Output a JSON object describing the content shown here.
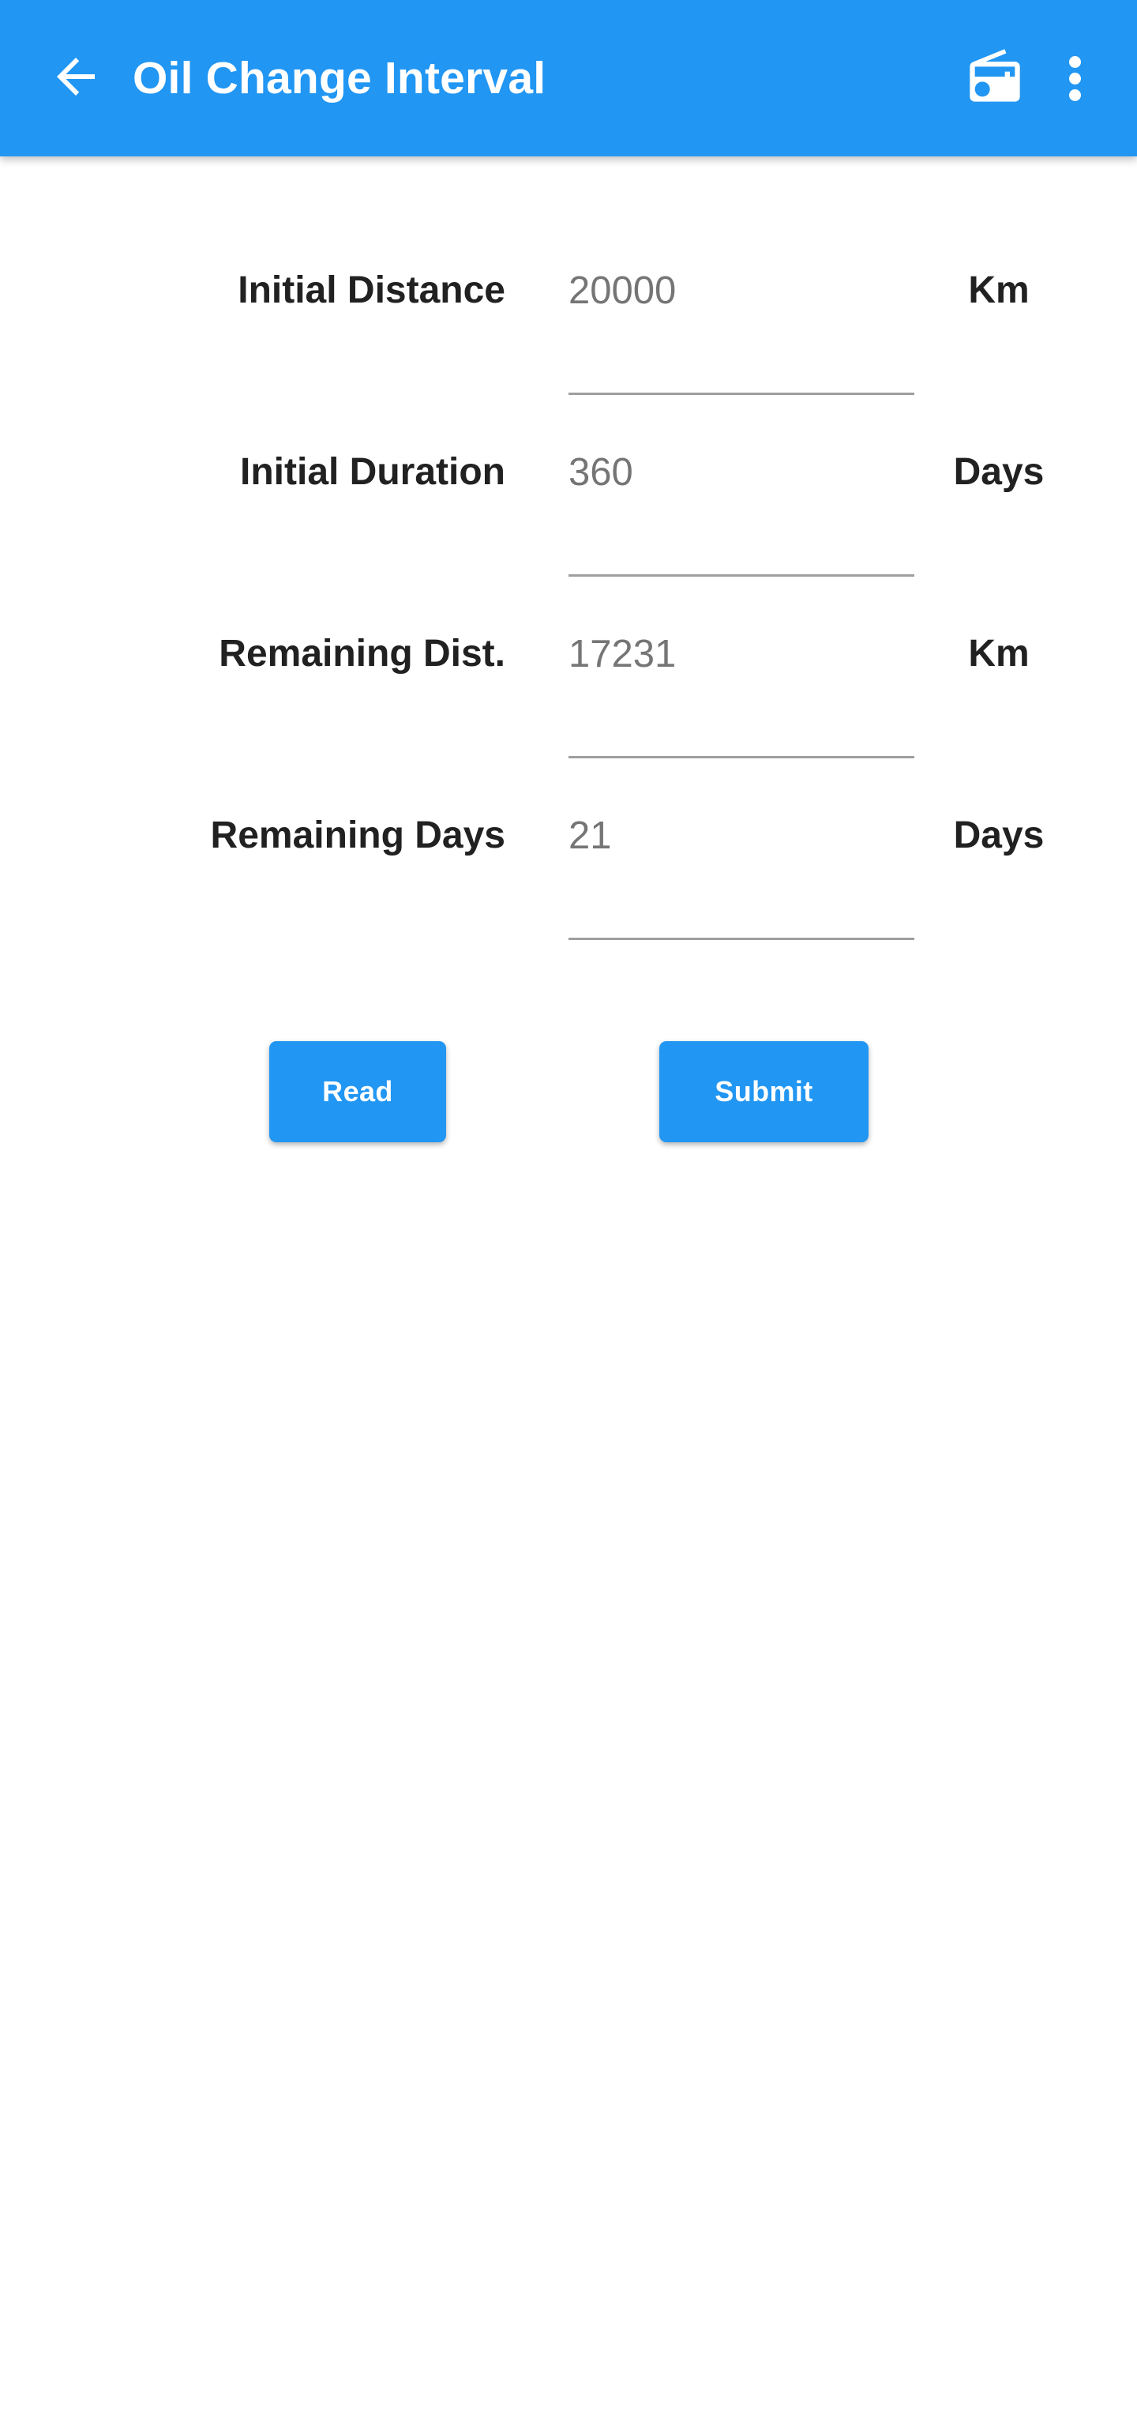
{
  "theme": {
    "primary": "#2196f3",
    "on_primary": "#ffffff",
    "label_color": "#212121",
    "value_color": "#757575",
    "underline_color": "#9e9e9e",
    "background": "#ffffff"
  },
  "appbar": {
    "title": "Oil Change Interval",
    "back_icon": "arrow-back-icon",
    "radio_icon": "radio-icon",
    "overflow_icon": "more-vert-icon"
  },
  "form": {
    "rows": [
      {
        "label": "Initial Distance",
        "value": "20000",
        "unit": "Km"
      },
      {
        "label": "Initial Duration",
        "value": "360",
        "unit": "Days"
      },
      {
        "label": "Remaining Dist.",
        "value": "17231",
        "unit": "Km"
      },
      {
        "label": "Remaining Days",
        "value": "21",
        "unit": "Days"
      }
    ]
  },
  "buttons": {
    "read_label": "Read",
    "submit_label": "Submit"
  }
}
